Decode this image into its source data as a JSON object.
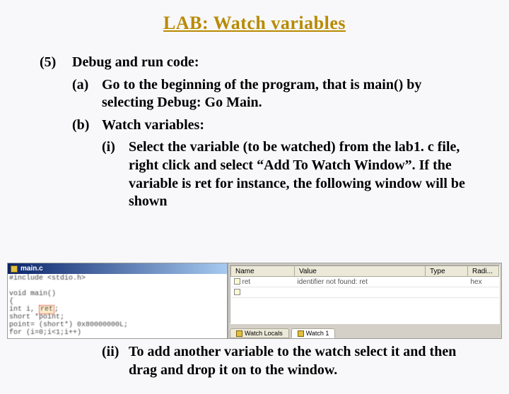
{
  "title": "LAB: Watch variables",
  "item5": {
    "num": "(5)",
    "text": "Debug and run code:"
  },
  "a": {
    "num": "(a)",
    "text": "Go to the beginning of the program, that is main() by selecting Debug: Go Main."
  },
  "b": {
    "num": "(b)",
    "text": "Watch variables:"
  },
  "i": {
    "num": "(i)",
    "text": "Select the variable (to be watched) from the lab1. c file, right click and select “Add To Watch Window”.  If the variable is ret for instance, the following window will be shown"
  },
  "ii": {
    "num": "(ii)",
    "text": "To add another variable to the watch select it and then drag and drop it on to the window."
  },
  "screenshot": {
    "left_title": "main.c",
    "left_lines": [
      "#include <stdio.h>",
      "",
      "void main()",
      "{",
      "   int i, ret;",
      "   short *point;",
      "   point= (short*) 0x80000000L;",
      "   for (i=0;i<1;i++)"
    ],
    "hl_token": "ret",
    "headers": {
      "name": "Name",
      "value": "Value",
      "type": "Type",
      "radix": "Radi..."
    },
    "rows": [
      {
        "name": "ret",
        "value": "identifier not found: ret",
        "type": "",
        "radix": "hex"
      },
      {
        "name": "",
        "value": "",
        "type": "",
        "radix": ""
      }
    ],
    "tabs": {
      "t1": "Watch Locals",
      "t2": "Watch 1"
    }
  }
}
